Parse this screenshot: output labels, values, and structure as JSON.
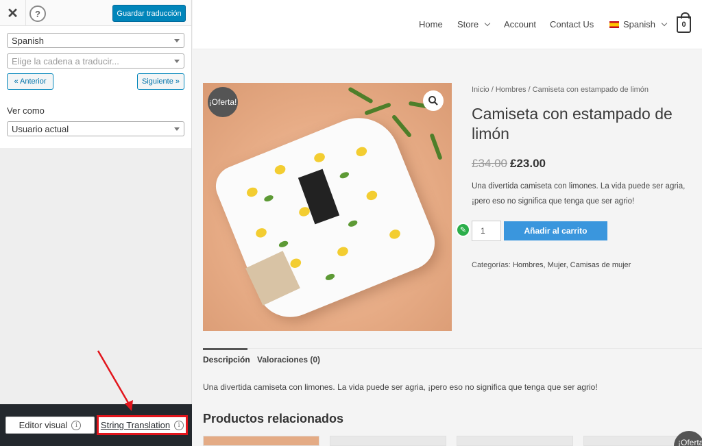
{
  "panel": {
    "close_icon": "close-icon",
    "help_icon": "help-icon",
    "save_label": "Guardar traducción",
    "language_select": "Spanish",
    "string_select_placeholder": "Elige la cadena a traducir...",
    "prev_label": "« Anterior",
    "next_label": "Siguiente »",
    "view_as_label": "Ver como",
    "view_as_select": "Usuario actual",
    "editor_visual_label": "Editor visual",
    "string_translation_label": "String Translation",
    "highlight_color": "#e2151c"
  },
  "header": {
    "nav": [
      "Home",
      "Store",
      "Account",
      "Contact Us"
    ],
    "language": "Spanish",
    "cart_count": "0"
  },
  "product": {
    "sale_badge": "¡Oferta!",
    "breadcrumb": "Inicio / Hombres / Camiseta con estampado de limón",
    "title": "Camiseta con estampado de limón",
    "old_price": "£34.00",
    "price": "£23.00",
    "short_description": "Una divertida camiseta con limones. La vida puede ser agria, ¡pero eso no significa que tenga que ser agrio!",
    "quantity": "1",
    "add_to_cart_label": "Añadir al carrito",
    "categories_label": "Categorías:",
    "categories": "Hombres, Mujer, Camisas de mujer"
  },
  "tabs": {
    "description": "Descripción",
    "reviews": "Valoraciones (0)",
    "description_text": "Una divertida camiseta con limones. La vida puede ser agria, ¡pero eso no significa que tenga que ser agrio!"
  },
  "related": {
    "title": "Productos relacionados",
    "badge": "¡Oferta"
  },
  "colors": {
    "accent": "#0085ba",
    "button": "#3a96dd",
    "panel_footer": "#23282d"
  }
}
